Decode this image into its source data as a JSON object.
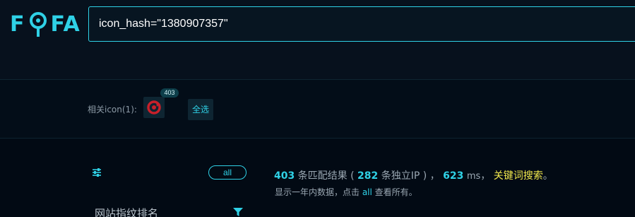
{
  "logo": {
    "text_left": "F",
    "text_right": "FA"
  },
  "search": {
    "query": "icon_hash=\"1380907357\""
  },
  "related_icons": {
    "label": "相关icon(1):",
    "count_badge": "403",
    "select_all_label": "全选"
  },
  "results": {
    "all_pill_label": "all",
    "total_count": "403",
    "total_suffix": " 条匹配结果 ( ",
    "unique_ip_count": "282",
    "unique_ip_suffix": " 条独立IP ) ，",
    "time_value": "623",
    "time_unit": "ms",
    "separator": "，",
    "keyword_search_label": "关键词搜索",
    "end_punctuation": "。",
    "note_prefix": "显示一年内数据，点击 ",
    "note_link": "all",
    "note_suffix": " 查看所有。",
    "rank_title": "网站指纹排名"
  },
  "colors": {
    "accent": "#2fd1e6",
    "keyword": "#f3e94d",
    "background": "#020a14"
  },
  "icons": {
    "logo_o": "magnifier-pin-icon",
    "favicon": "red-circle-arrow-icon",
    "filter": "sliders-icon",
    "funnel": "funnel-filter-icon"
  }
}
